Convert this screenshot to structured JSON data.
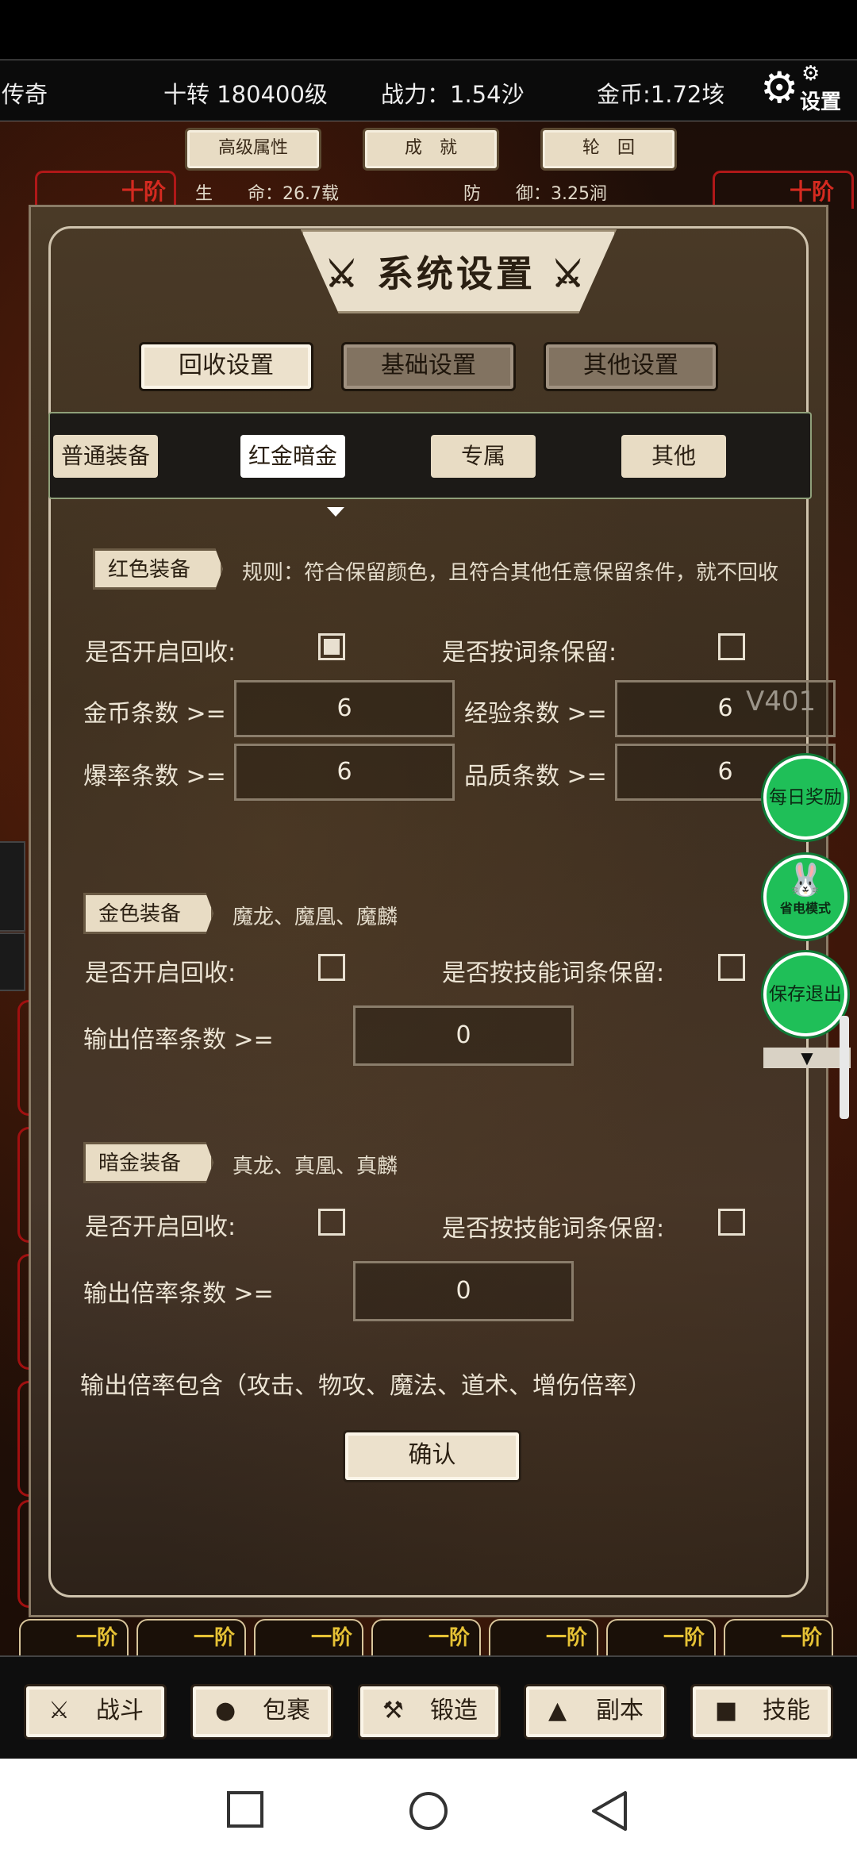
{
  "top_bar": {
    "rank": "传奇",
    "level": "十转 180400级",
    "power": "战力：1.54沙",
    "gold": "金币:1.72垓",
    "settings_label": "设置"
  },
  "header_buttons": [
    "高级属性",
    "成　就",
    "轮　回"
  ],
  "stats": {
    "hp": "生　　命：26.7载",
    "def": "防　　御：3.25涧"
  },
  "tier_top_left": "十阶",
  "tier_top_right": "十阶",
  "dialog": {
    "title": "⚔ 系统设置 ⚔",
    "tabs": [
      {
        "label": "回收设置",
        "active": true
      },
      {
        "label": "基础设置",
        "active": false
      },
      {
        "label": "其他设置",
        "active": false
      }
    ],
    "subtabs": [
      {
        "label": "普通装备",
        "selected": false
      },
      {
        "label": "红金暗金",
        "selected": true
      },
      {
        "label": "专属",
        "selected": false
      },
      {
        "label": "其他",
        "selected": false
      }
    ],
    "red_section": {
      "tag": "红色装备",
      "rule": "规则：符合保留颜色，且符合其他任意保留条件，就不回收",
      "enable_label": "是否开启回收:",
      "enable_checked": true,
      "keep_label": "是否按词条保留:",
      "keep_checked": false,
      "gold_label": "金币条数  >=",
      "gold_value": "6",
      "exp_label": "经验条数  >=",
      "exp_value": "6",
      "drop_label": "爆率条数  >=",
      "drop_value": "6",
      "quality_label": "品质条数  >=",
      "quality_value": "6"
    },
    "version": "V401",
    "gold_section": {
      "tag": "金色装备",
      "desc": "魔龙、魔凰、魔麟",
      "enable_label": "是否开启回收:",
      "enable_checked": false,
      "keep_label": "是否按技能词条保留:",
      "keep_checked": false,
      "output_label": "输出倍率条数 >=",
      "output_value": "0"
    },
    "dark_section": {
      "tag": "暗金装备",
      "desc": "真龙、真凰、真麟",
      "enable_label": "是否开启回收:",
      "enable_checked": false,
      "keep_label": "是否按技能词条保留:",
      "keep_checked": false,
      "output_label": "输出倍率条数  >=",
      "output_value": "0"
    },
    "footnote": "输出倍率包含（攻击、物攻、魔法、道术、增伤倍率）",
    "confirm": "确认"
  },
  "float_buttons": {
    "daily": "每日奖励",
    "power_saving": "省电模式",
    "save_exit": "保存退出"
  },
  "tier_tabs": [
    "一阶",
    "一阶",
    "一阶",
    "一阶",
    "一阶",
    "一阶",
    "一阶"
  ],
  "bottom_nav": [
    {
      "label": "战斗",
      "icon": "crossed-swords-icon"
    },
    {
      "label": "包裹",
      "icon": "bag-icon"
    },
    {
      "label": "锻造",
      "icon": "hammer-icon"
    },
    {
      "label": "副本",
      "icon": "tower-icon"
    },
    {
      "label": "技能",
      "icon": "book-icon"
    }
  ]
}
